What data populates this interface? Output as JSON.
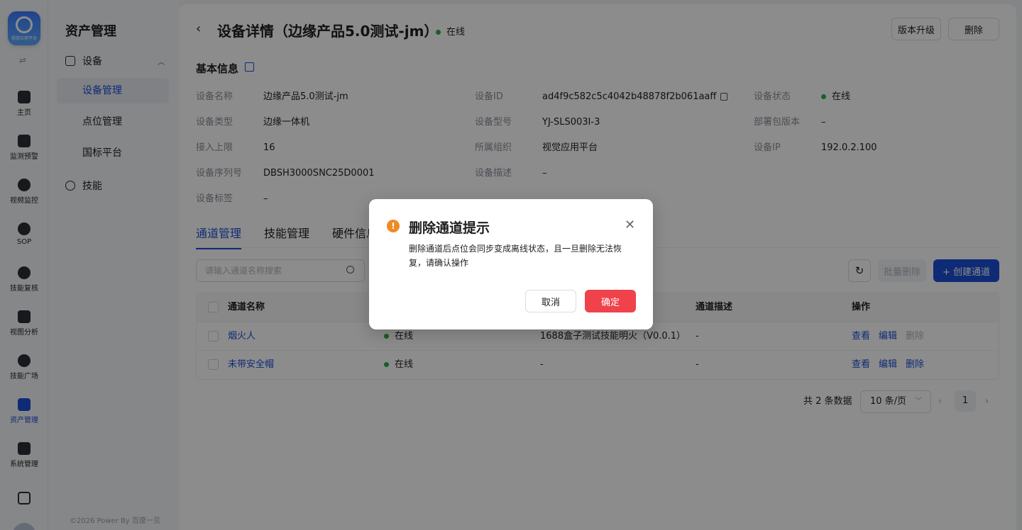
{
  "rail": {
    "logo_caption": "视觉应用平台",
    "toggle": "⇌",
    "items": [
      {
        "label": "主页"
      },
      {
        "label": "监测预警"
      },
      {
        "label": "视频监控"
      },
      {
        "label": "SOP"
      },
      {
        "label": "技能复核"
      },
      {
        "label": "视图分析"
      },
      {
        "label": "技能广场"
      },
      {
        "label": "资产管理"
      },
      {
        "label": "系统管理"
      }
    ]
  },
  "subnav": {
    "title": "资产管理",
    "group_device": "设备",
    "items": [
      "设备管理",
      "点位管理",
      "国标平台"
    ],
    "group_skill": "技能",
    "copyright": "©2026 Power By 百度一见"
  },
  "header": {
    "back": "‹",
    "title": "设备详情（边缘产品5.0测试-jm）",
    "status": "在线",
    "upgrade_label": "版本升级",
    "delete_label": "删除"
  },
  "basic": {
    "title": "基本信息",
    "fields": [
      {
        "k": "设备名称",
        "v": "边缘产品5.0测试-jm"
      },
      {
        "k": "设备ID",
        "v": "ad4f9c582c5c4042b48878f2b061aaff"
      },
      {
        "k": "设备状态",
        "v": "在线"
      },
      {
        "k": "设备类型",
        "v": "边缘一体机"
      },
      {
        "k": "设备型号",
        "v": "YJ-SLS003I-3"
      },
      {
        "k": "部署包版本",
        "v": "–"
      },
      {
        "k": "接入上限",
        "v": "16"
      },
      {
        "k": "所属组织",
        "v": "视觉应用平台"
      },
      {
        "k": "设备IP",
        "v": "192.0.2.100"
      },
      {
        "k": "设备序列号",
        "v": "DBSH3000SNC25D0001"
      },
      {
        "k": "设备描述",
        "v": "–"
      },
      {
        "k": "设备标签",
        "v": "–"
      }
    ]
  },
  "tabs": [
    "通道管理",
    "技能管理",
    "硬件信息"
  ],
  "toolbar": {
    "search_placeholder": "请输入通道名称搜索",
    "refresh": "↻",
    "batch_delete": "批量删除",
    "create": "+ 创建通道"
  },
  "table": {
    "headers": [
      "通道名称",
      "通道描述",
      "操作"
    ],
    "rows": [
      {
        "name": "烟火人",
        "status": "在线",
        "skill": "1688盒子测试技能明火（V0.0.1）",
        "desc": "-",
        "ops": [
          "查看",
          "编辑",
          "删除"
        ]
      },
      {
        "name": "未带安全帽",
        "status": "在线",
        "skill": "-",
        "desc": "-",
        "ops": [
          "查看",
          "编辑",
          "删除"
        ]
      }
    ]
  },
  "pagination": {
    "total": "共 2 条数据",
    "page_size": "10 条/页",
    "prev": "‹",
    "current": "1",
    "next": "›"
  },
  "modal": {
    "icon": "!",
    "title": "删除通道提示",
    "close": "✕",
    "body": "删除通道后点位会同步变成离线状态，且一旦删除无法恢复，请确认操作",
    "cancel": "取消",
    "confirm": "确定"
  },
  "colors": {
    "primary": "#1d4fd8",
    "online": "#27b148",
    "danger": "#f0424a",
    "warning": "#f08a24"
  }
}
